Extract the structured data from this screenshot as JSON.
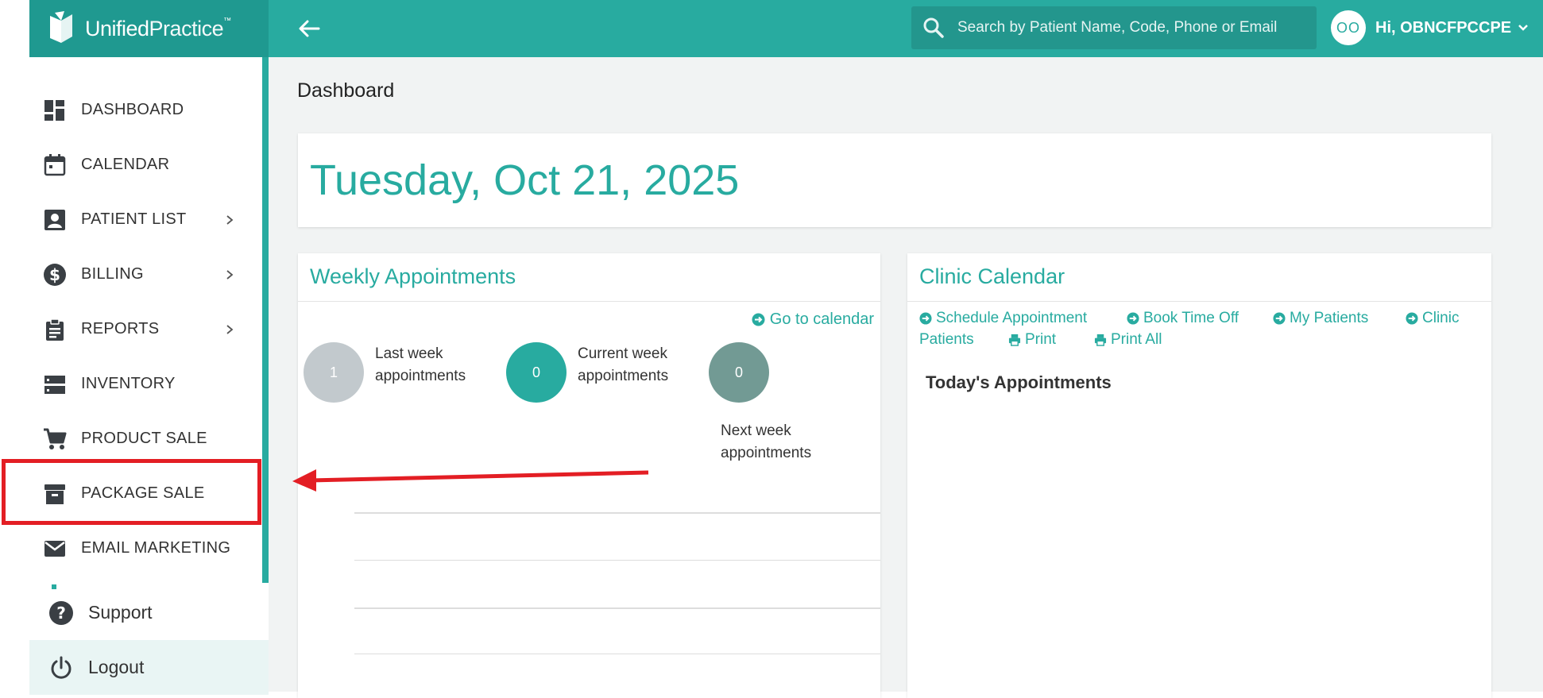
{
  "brand": {
    "name_bold": "Unified",
    "name_light": "Practice",
    "tm": "™"
  },
  "search": {
    "placeholder": "Search by Patient Name, Code, Phone or Email"
  },
  "user": {
    "initials": "OO",
    "greeting": "Hi, OBNCFPCCPE"
  },
  "sidebar": {
    "items": [
      {
        "label": "DASHBOARD",
        "icon": "dashboard-icon",
        "has_submenu": false
      },
      {
        "label": "CALENDAR",
        "icon": "calendar-icon",
        "has_submenu": false
      },
      {
        "label": "PATIENT LIST",
        "icon": "patient-icon",
        "has_submenu": true
      },
      {
        "label": "BILLING",
        "icon": "dollar-icon",
        "has_submenu": true
      },
      {
        "label": "REPORTS",
        "icon": "clipboard-icon",
        "has_submenu": true
      },
      {
        "label": "INVENTORY",
        "icon": "inventory-icon",
        "has_submenu": false
      },
      {
        "label": "PRODUCT SALE",
        "icon": "cart-icon",
        "has_submenu": false
      },
      {
        "label": "PACKAGE SALE",
        "icon": "archive-icon",
        "has_submenu": false
      },
      {
        "label": "EMAIL MARKETING",
        "icon": "mail-icon",
        "has_submenu": false
      }
    ],
    "support": "Support",
    "logout": "Logout"
  },
  "main": {
    "page_title": "Dashboard",
    "date": "Tuesday, Oct 21, 2025"
  },
  "weekly": {
    "title": "Weekly Appointments",
    "goto_label": "Go to calendar",
    "stats": [
      {
        "value": "1",
        "label_line1": "Last week",
        "label_line2": "appointments",
        "color": "#c2c9cd"
      },
      {
        "value": "0",
        "label_line1": "Current week",
        "label_line2": "appointments",
        "color": "#28aba0"
      },
      {
        "value": "0",
        "label_line1": "Next week",
        "label_line2": "appointments",
        "color": "#729a94"
      }
    ]
  },
  "clinic": {
    "title": "Clinic Calendar",
    "links": {
      "schedule": "Schedule Appointment",
      "book_off": "Book Time Off",
      "my_patients": "My Patients",
      "clinic_patients_1": "Clinic",
      "clinic_patients_2": "Patients",
      "print": "Print",
      "print_all": "Print All"
    },
    "today_heading": "Today's Appointments"
  },
  "colors": {
    "accent": "#28aba0",
    "brand_dark": "#1f9990",
    "annotation": "#e31e24"
  }
}
